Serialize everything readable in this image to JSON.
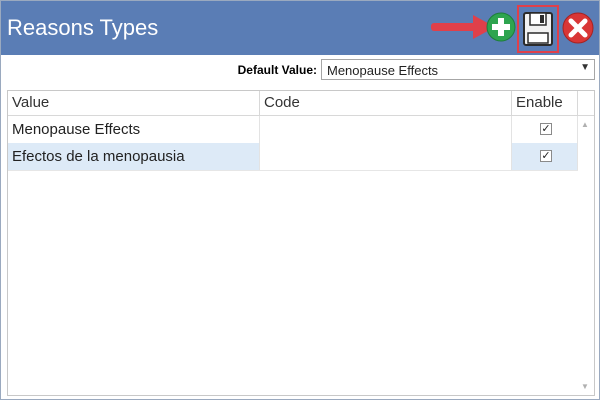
{
  "window": {
    "title": "Reasons Types"
  },
  "toolbar": {
    "add_icon": "add-circle-icon",
    "save_icon": "floppy-disk-icon",
    "close_icon": "close-circle-icon",
    "arrow_icon": "red-arrow-icon",
    "highlight_color": "#e0404a"
  },
  "default_value": {
    "label": "Default Value:",
    "selected": "Menopause Effects"
  },
  "grid": {
    "columns": [
      "Value",
      "Code",
      "Enable"
    ],
    "rows": [
      {
        "value": "Menopause Effects",
        "code": "",
        "enable": "✓"
      },
      {
        "value": "Efectos de la menopausia",
        "code": "",
        "enable": "✓"
      }
    ]
  },
  "colors": {
    "titlebar": "#5a7db5",
    "selected_row": "#ddeaf7"
  }
}
